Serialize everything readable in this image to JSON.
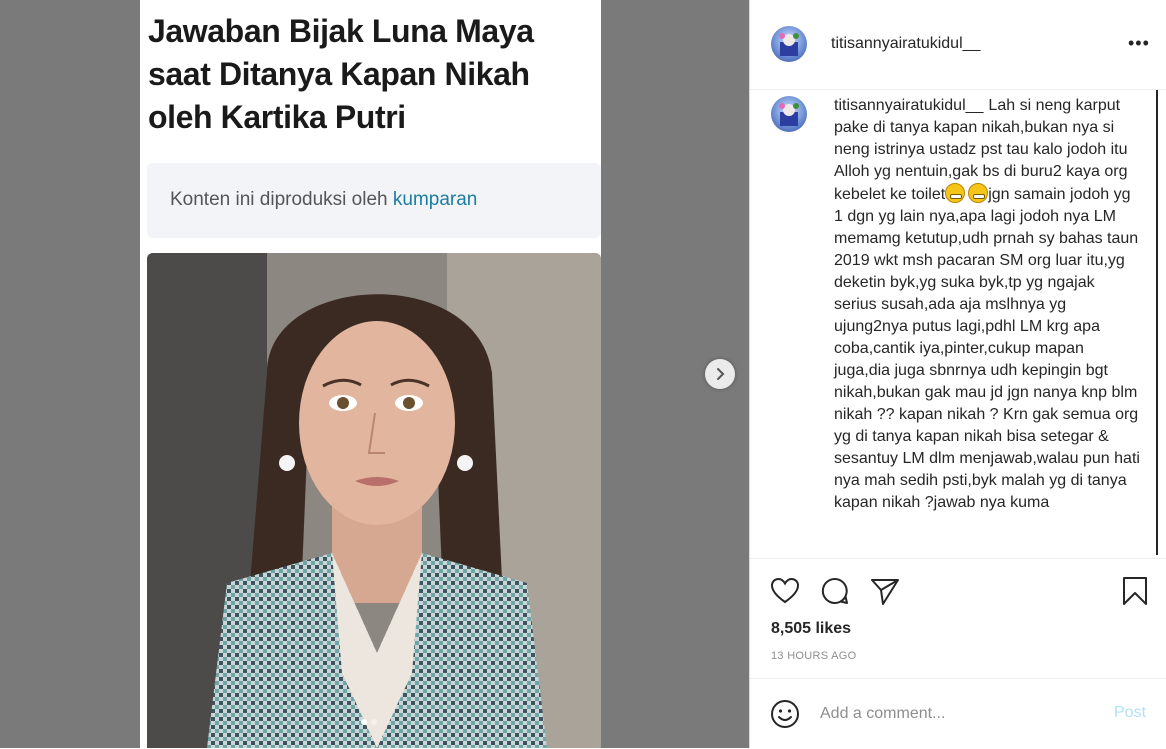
{
  "post": {
    "media": {
      "headline": "Jawaban Bijak Luna Maya saat Ditanya Kapan Nikah oleh Kartika Putri",
      "credit_prefix": "Konten ini diproduksi oleh ",
      "credit_source": "kumparan",
      "carousel": {
        "slide_count": 2,
        "active_index": 0
      }
    },
    "header": {
      "username": "titisannyairatukidul__",
      "more_icon": "more-horizontal-icon"
    },
    "caption": {
      "username": "titisannyairatukidul__",
      "text_before_emoji": "Lah si neng karput pake di tanya kapan nikah,bukan nya si neng istrinya ustadz pst tau kalo jodoh itu Alloh yg nentuin,gak bs di buru2 kaya org kebelet ke toilet",
      "emojis": [
        "grimacing-face-emoji",
        "smiling-face-emoji"
      ],
      "text_after_emoji": "jgn samain jodoh yg 1 dgn yg lain nya,apa lagi jodoh nya LM memamg ketutup,udh prnah sy bahas taun 2019 wkt msh pacaran SM org luar itu,yg deketin byk,yg suka byk,tp yg ngajak serius susah,ada aja mslhnya yg ujung2nya putus lagi,pdhl LM krg apa coba,cantik iya,pinter,cukup mapan juga,dia juga sbnrnya udh kepingin bgt nikah,bukan gak mau jd jgn nanya knp blm nikah ?? kapan nikah ? Krn gak semua org yg di tanya kapan nikah bisa setegar & sesantuy LM dlm menjawab,walau pun hati nya mah sedih psti,byk malah yg di tanya kapan nikah ?jawab nya kuma"
    },
    "actions": {
      "icons": [
        "heart-icon",
        "comment-icon",
        "share-icon",
        "bookmark-icon"
      ]
    },
    "likes": "8,505 likes",
    "timestamp": "13 HOURS AGO",
    "add_comment": {
      "placeholder": "Add a comment...",
      "post_label": "Post"
    },
    "colors": {
      "link": "#1b7da0",
      "post_button_disabled": "#b2dffc",
      "muted": "#8e8e8e",
      "media_bg": "#7a7a7a"
    }
  }
}
